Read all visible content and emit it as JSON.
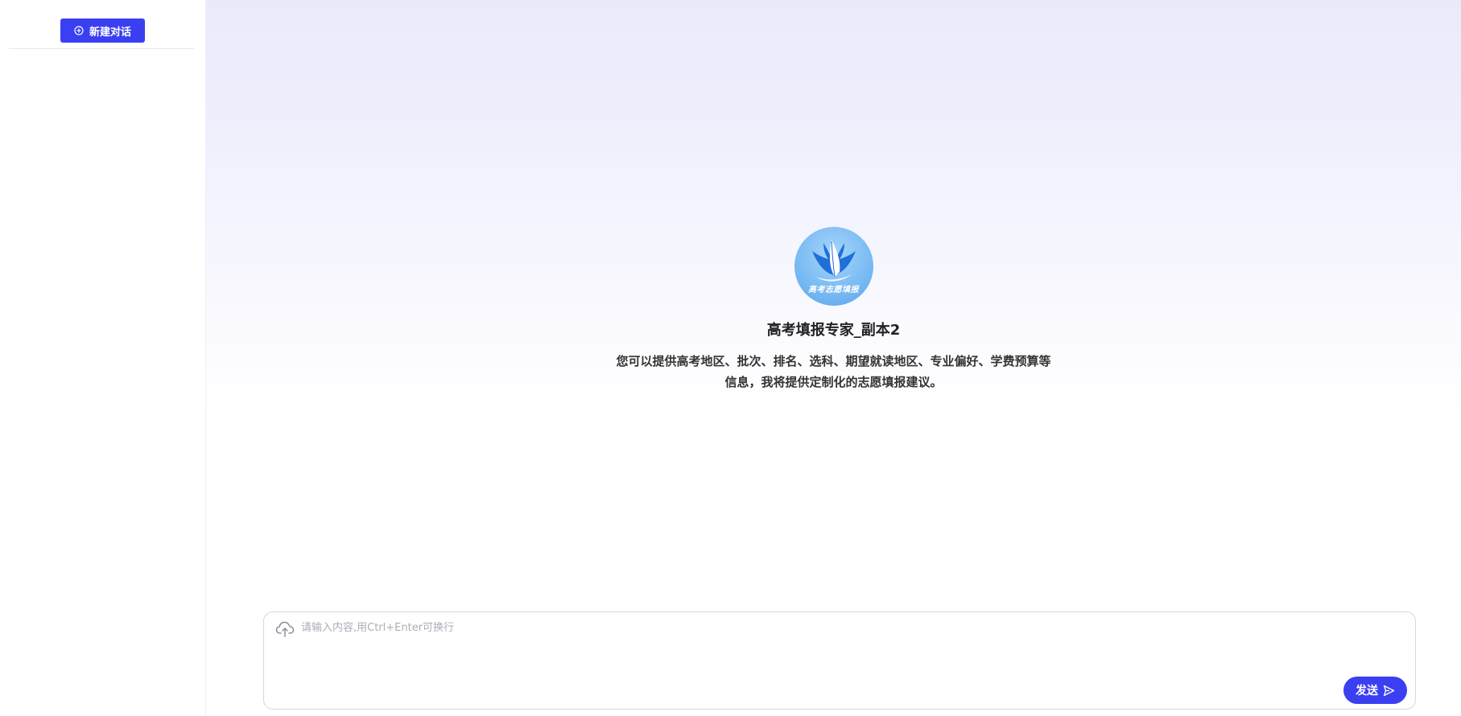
{
  "sidebar": {
    "new_chat_label": "新建对话",
    "new_chat_icon": "plus-circle-icon"
  },
  "agent": {
    "logo_text": "高考志愿填报",
    "title": "高考填报专家_副本2",
    "description": "您可以提供高考地区、批次、排名、选科、期望就读地区、专业偏好、学费预算等信息，我将提供定制化的志愿填报建议。"
  },
  "composer": {
    "placeholder": "请输入内容,用Ctrl+Enter可换行",
    "upload_icon": "cloud-upload-icon",
    "send_label": "发送",
    "send_icon": "send-arrow-icon"
  },
  "colors": {
    "accent": "#3b3ff2",
    "logo_blue": "#7bbcf3"
  }
}
